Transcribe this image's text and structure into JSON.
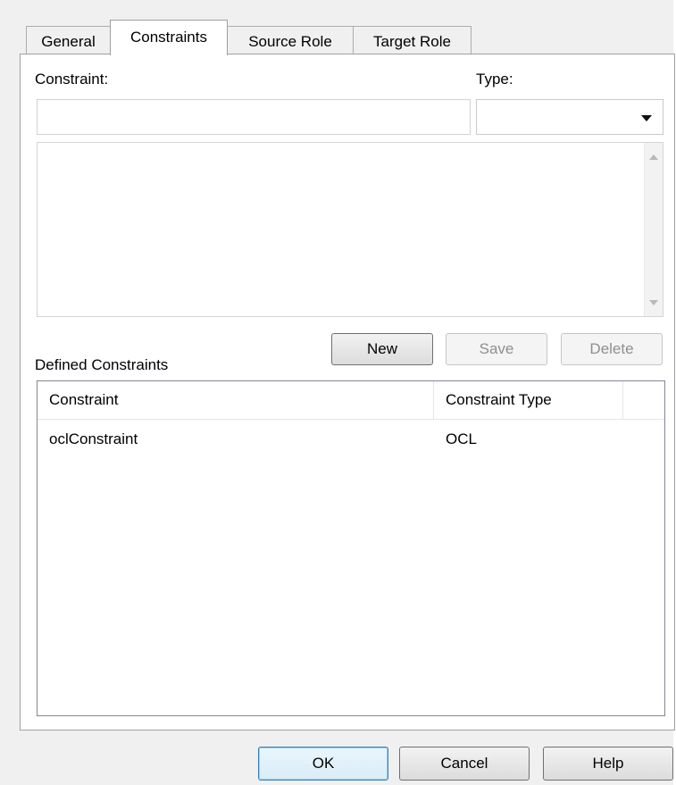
{
  "tabs": [
    {
      "label": "General",
      "active": false
    },
    {
      "label": "Constraints",
      "active": true
    },
    {
      "label": "Source Role",
      "active": false
    },
    {
      "label": "Target Role",
      "active": false
    }
  ],
  "constraint_field": {
    "label": "Constraint:",
    "value": ""
  },
  "type_field": {
    "label": "Type:",
    "selected": ""
  },
  "editor": {
    "text": ""
  },
  "buttons": {
    "new": "New",
    "save": "Save",
    "delete": "Delete",
    "ok": "OK",
    "cancel": "Cancel",
    "help": "Help"
  },
  "defined_constraints": {
    "label": "Defined Constraints",
    "columns": [
      "Constraint",
      "Constraint Type"
    ],
    "rows": [
      {
        "constraint": "oclConstraint",
        "type": "OCL"
      }
    ]
  }
}
